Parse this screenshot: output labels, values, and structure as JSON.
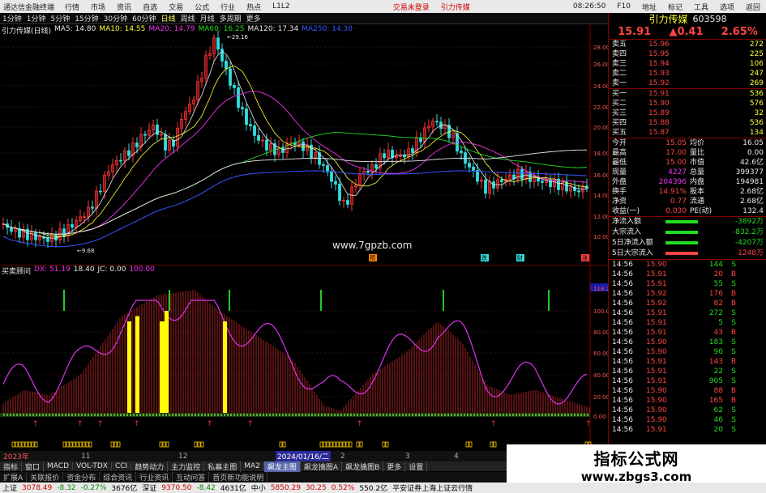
{
  "menubar": {
    "app_title": "通达信金融终端",
    "items": [
      "行情",
      "市场",
      "资讯",
      "自选",
      "交易",
      "公式",
      "行业",
      "热点",
      "L1L2"
    ],
    "center_items": [
      "交易未登录",
      "引力传媒"
    ],
    "right_items": [
      "F10",
      "地址",
      "标记",
      "工具",
      "选项",
      "返回"
    ],
    "time": "08:26:50"
  },
  "toolbar": {
    "periods": [
      "1分钟",
      "1分钟",
      "5分钟",
      "15分钟",
      "30分钟",
      "60分钟",
      "日线",
      "周线",
      "月线",
      "多周期",
      "更多"
    ],
    "active": "日线"
  },
  "main_legend": {
    "title": "引力传媒(日线)",
    "items": [
      {
        "text": "MA5: 14.80",
        "color": "#e8e8e8"
      },
      {
        "text": "MA10: 14.55",
        "color": "#ffff33"
      },
      {
        "text": "MA20: 14.79",
        "color": "#ee33ee"
      },
      {
        "text": "MA60: 16.25",
        "color": "#22dd22"
      },
      {
        "text": "MA120: 17.34",
        "color": "#e8e8e8"
      },
      {
        "text": "MA250: 14.30",
        "color": "#3355ff"
      }
    ]
  },
  "price_axis": [
    "28.00",
    "26.00",
    "24.00",
    "22.00",
    "20.00",
    "18.00",
    "16.00",
    "14.00",
    "12.00",
    "10.00"
  ],
  "annotations": {
    "high": "29.16",
    "low": "9.68",
    "watermark_site": "www.7gpzb.com",
    "markers": [
      "预",
      "跌",
      "财",
      "涨"
    ]
  },
  "sub_legend": {
    "title": "买卖顾问",
    "items": [
      {
        "text": "DX: 51.19",
        "color": "#ee33ee"
      },
      {
        "text": "18.40",
        "color": "#e8e8e8"
      },
      {
        "text": "JC: 0.00",
        "color": "#e8e8e8"
      },
      {
        "text": "100.00",
        "color": "#ee33ee"
      }
    ]
  },
  "sub_axis": [
    "118.23",
    "100.00",
    "80.00",
    "60.00",
    "40.00",
    "20.00",
    "0.00"
  ],
  "date_axis": {
    "left": "2023年",
    "highlight": "2024/01/16/二",
    "marks": [
      "11",
      "12",
      "2",
      "3",
      "4",
      "5",
      "6"
    ]
  },
  "indicator_tabs": [
    "指标",
    "窗口",
    "MACD",
    "VOL-TDX",
    "CCI",
    "趋势动力",
    "主力监控",
    "私募主图",
    "MA2",
    "飙龙主图",
    "飙龙擒图A",
    "飙龙擒图B",
    "更多",
    "设置"
  ],
  "indicator_tabs_active": "飙龙主图",
  "bottom_tabs": [
    "扩展A",
    "关联报价",
    "资金分布",
    "综合资讯",
    "行业资讯",
    "互动问答",
    "首页新功能说明"
  ],
  "ticker": [
    {
      "text": "上证",
      "color": "#000"
    },
    {
      "text": "3078.49",
      "color": "#d00000"
    },
    {
      "text": "-8.32",
      "color": "#008800"
    },
    {
      "text": "-0.27%",
      "color": "#008800"
    },
    {
      "text": "3676亿",
      "color": "#000"
    },
    {
      "text": "深证",
      "color": "#000"
    },
    {
      "text": "9370.50",
      "color": "#d00000"
    },
    {
      "text": "-8.42",
      "color": "#008800"
    },
    {
      "text": "4631亿",
      "color": "#000"
    },
    {
      "text": "中小",
      "color": "#000"
    },
    {
      "text": "5850.29",
      "color": "#d00000"
    },
    {
      "text": "30.25",
      "color": "#d00000"
    },
    {
      "text": "0.52%",
      "color": "#d00000"
    },
    {
      "text": "550.2亿",
      "color": "#000"
    },
    {
      "text": "平安证券上海上证云行情",
      "color": "#000"
    }
  ],
  "stock": {
    "name": "引力传媒",
    "code": "603598",
    "price": "15.91",
    "change": "0.41",
    "pct": "2.65%",
    "sell": [
      {
        "label": "卖五",
        "price": "15.96",
        "vol": "272"
      },
      {
        "label": "卖四",
        "price": "15.95",
        "vol": "225"
      },
      {
        "label": "卖三",
        "price": "15.94",
        "vol": "106"
      },
      {
        "label": "卖二",
        "price": "15.93",
        "vol": "247"
      },
      {
        "label": "卖一",
        "price": "15.92",
        "vol": "269"
      }
    ],
    "buy": [
      {
        "label": "买一",
        "price": "15.91",
        "vol": "536"
      },
      {
        "label": "买二",
        "price": "15.90",
        "vol": "576"
      },
      {
        "label": "买三",
        "price": "15.89",
        "vol": "32"
      },
      {
        "label": "买四",
        "price": "15.88",
        "vol": "536"
      },
      {
        "label": "买五",
        "price": "15.87",
        "vol": "134"
      }
    ],
    "stats": [
      {
        "l1": "今开",
        "v1": "15.05",
        "l2": "均价",
        "v2": "16.05"
      },
      {
        "l1": "最高",
        "v1": "17.00",
        "l2": "量比",
        "v2": "0.00"
      },
      {
        "l1": "最低",
        "v1": "15.00",
        "l2": "市值",
        "v2": "42.6亿"
      },
      {
        "l1": "现量",
        "v1": "4227",
        "l2": "总量",
        "v2": "399377"
      },
      {
        "l1": "外盘",
        "v1": "204396",
        "l2": "内盘",
        "v2": "194981"
      },
      {
        "l1": "换手",
        "v1": "14.91%",
        "l2": "股本",
        "v2": "2.68亿"
      },
      {
        "l1": "净资",
        "v1": "0.77",
        "l2": "流通",
        "v2": "2.68亿"
      },
      {
        "l1": "收益(一)",
        "v1": "0.030",
        "l2": "PE(动)",
        "v2": "132.4"
      }
    ],
    "flows": [
      {
        "label": "净流入额",
        "value": "-3892万",
        "color": "#22dd22"
      },
      {
        "label": "大宗流入",
        "value": "-832.2万",
        "color": "#22dd22"
      },
      {
        "label": "5日净流入额",
        "value": "-4207万",
        "color": "#22dd22"
      },
      {
        "label": "5日大宗流入",
        "value": "1248万",
        "color": "#ff4444"
      }
    ],
    "ticks": [
      {
        "t": "14:56",
        "p": "15.90",
        "v": "144",
        "d": "S"
      },
      {
        "t": "14:56",
        "p": "15.91",
        "v": "20",
        "d": "B"
      },
      {
        "t": "14:56",
        "p": "15.91",
        "v": "55",
        "d": "S"
      },
      {
        "t": "14:56",
        "p": "15.92",
        "v": "176",
        "d": "B"
      },
      {
        "t": "14:56",
        "p": "15.92",
        "v": "82",
        "d": "B"
      },
      {
        "t": "14:56",
        "p": "15.91",
        "v": "272",
        "d": "S"
      },
      {
        "t": "14:56",
        "p": "15.91",
        "v": "5",
        "d": "S"
      },
      {
        "t": "14:56",
        "p": "15.91",
        "v": "43",
        "d": "B"
      },
      {
        "t": "14:56",
        "p": "15.90",
        "v": "183",
        "d": "S"
      },
      {
        "t": "14:56",
        "p": "15.90",
        "v": "90",
        "d": "S"
      },
      {
        "t": "14:56",
        "p": "15.91",
        "v": "143",
        "d": "B"
      },
      {
        "t": "14:56",
        "p": "15.91",
        "v": "22",
        "d": "S"
      },
      {
        "t": "14:56",
        "p": "15.91",
        "v": "905",
        "d": "S"
      },
      {
        "t": "14:56",
        "p": "15.90",
        "v": "88",
        "d": "B"
      },
      {
        "t": "14:56",
        "p": "15.90",
        "v": "165",
        "d": "B"
      },
      {
        "t": "14:56",
        "p": "15.90",
        "v": "62",
        "d": "S"
      },
      {
        "t": "14:56",
        "p": "15.90",
        "v": "46",
        "d": "S"
      },
      {
        "t": "14:56",
        "p": "15.91",
        "v": "20",
        "d": "S"
      }
    ]
  },
  "watermark": {
    "line1": "指标公式网",
    "line2": "www.zbgs3.com"
  },
  "colors": {
    "up": "#ff3333",
    "down": "#33dddd",
    "ma5": "#e8e8e8",
    "ma10": "#ffff33",
    "ma20": "#ee33ee",
    "ma60": "#22dd22",
    "ma250": "#3355ff",
    "bars": "#aa2222",
    "signal": "#ffff00"
  }
}
